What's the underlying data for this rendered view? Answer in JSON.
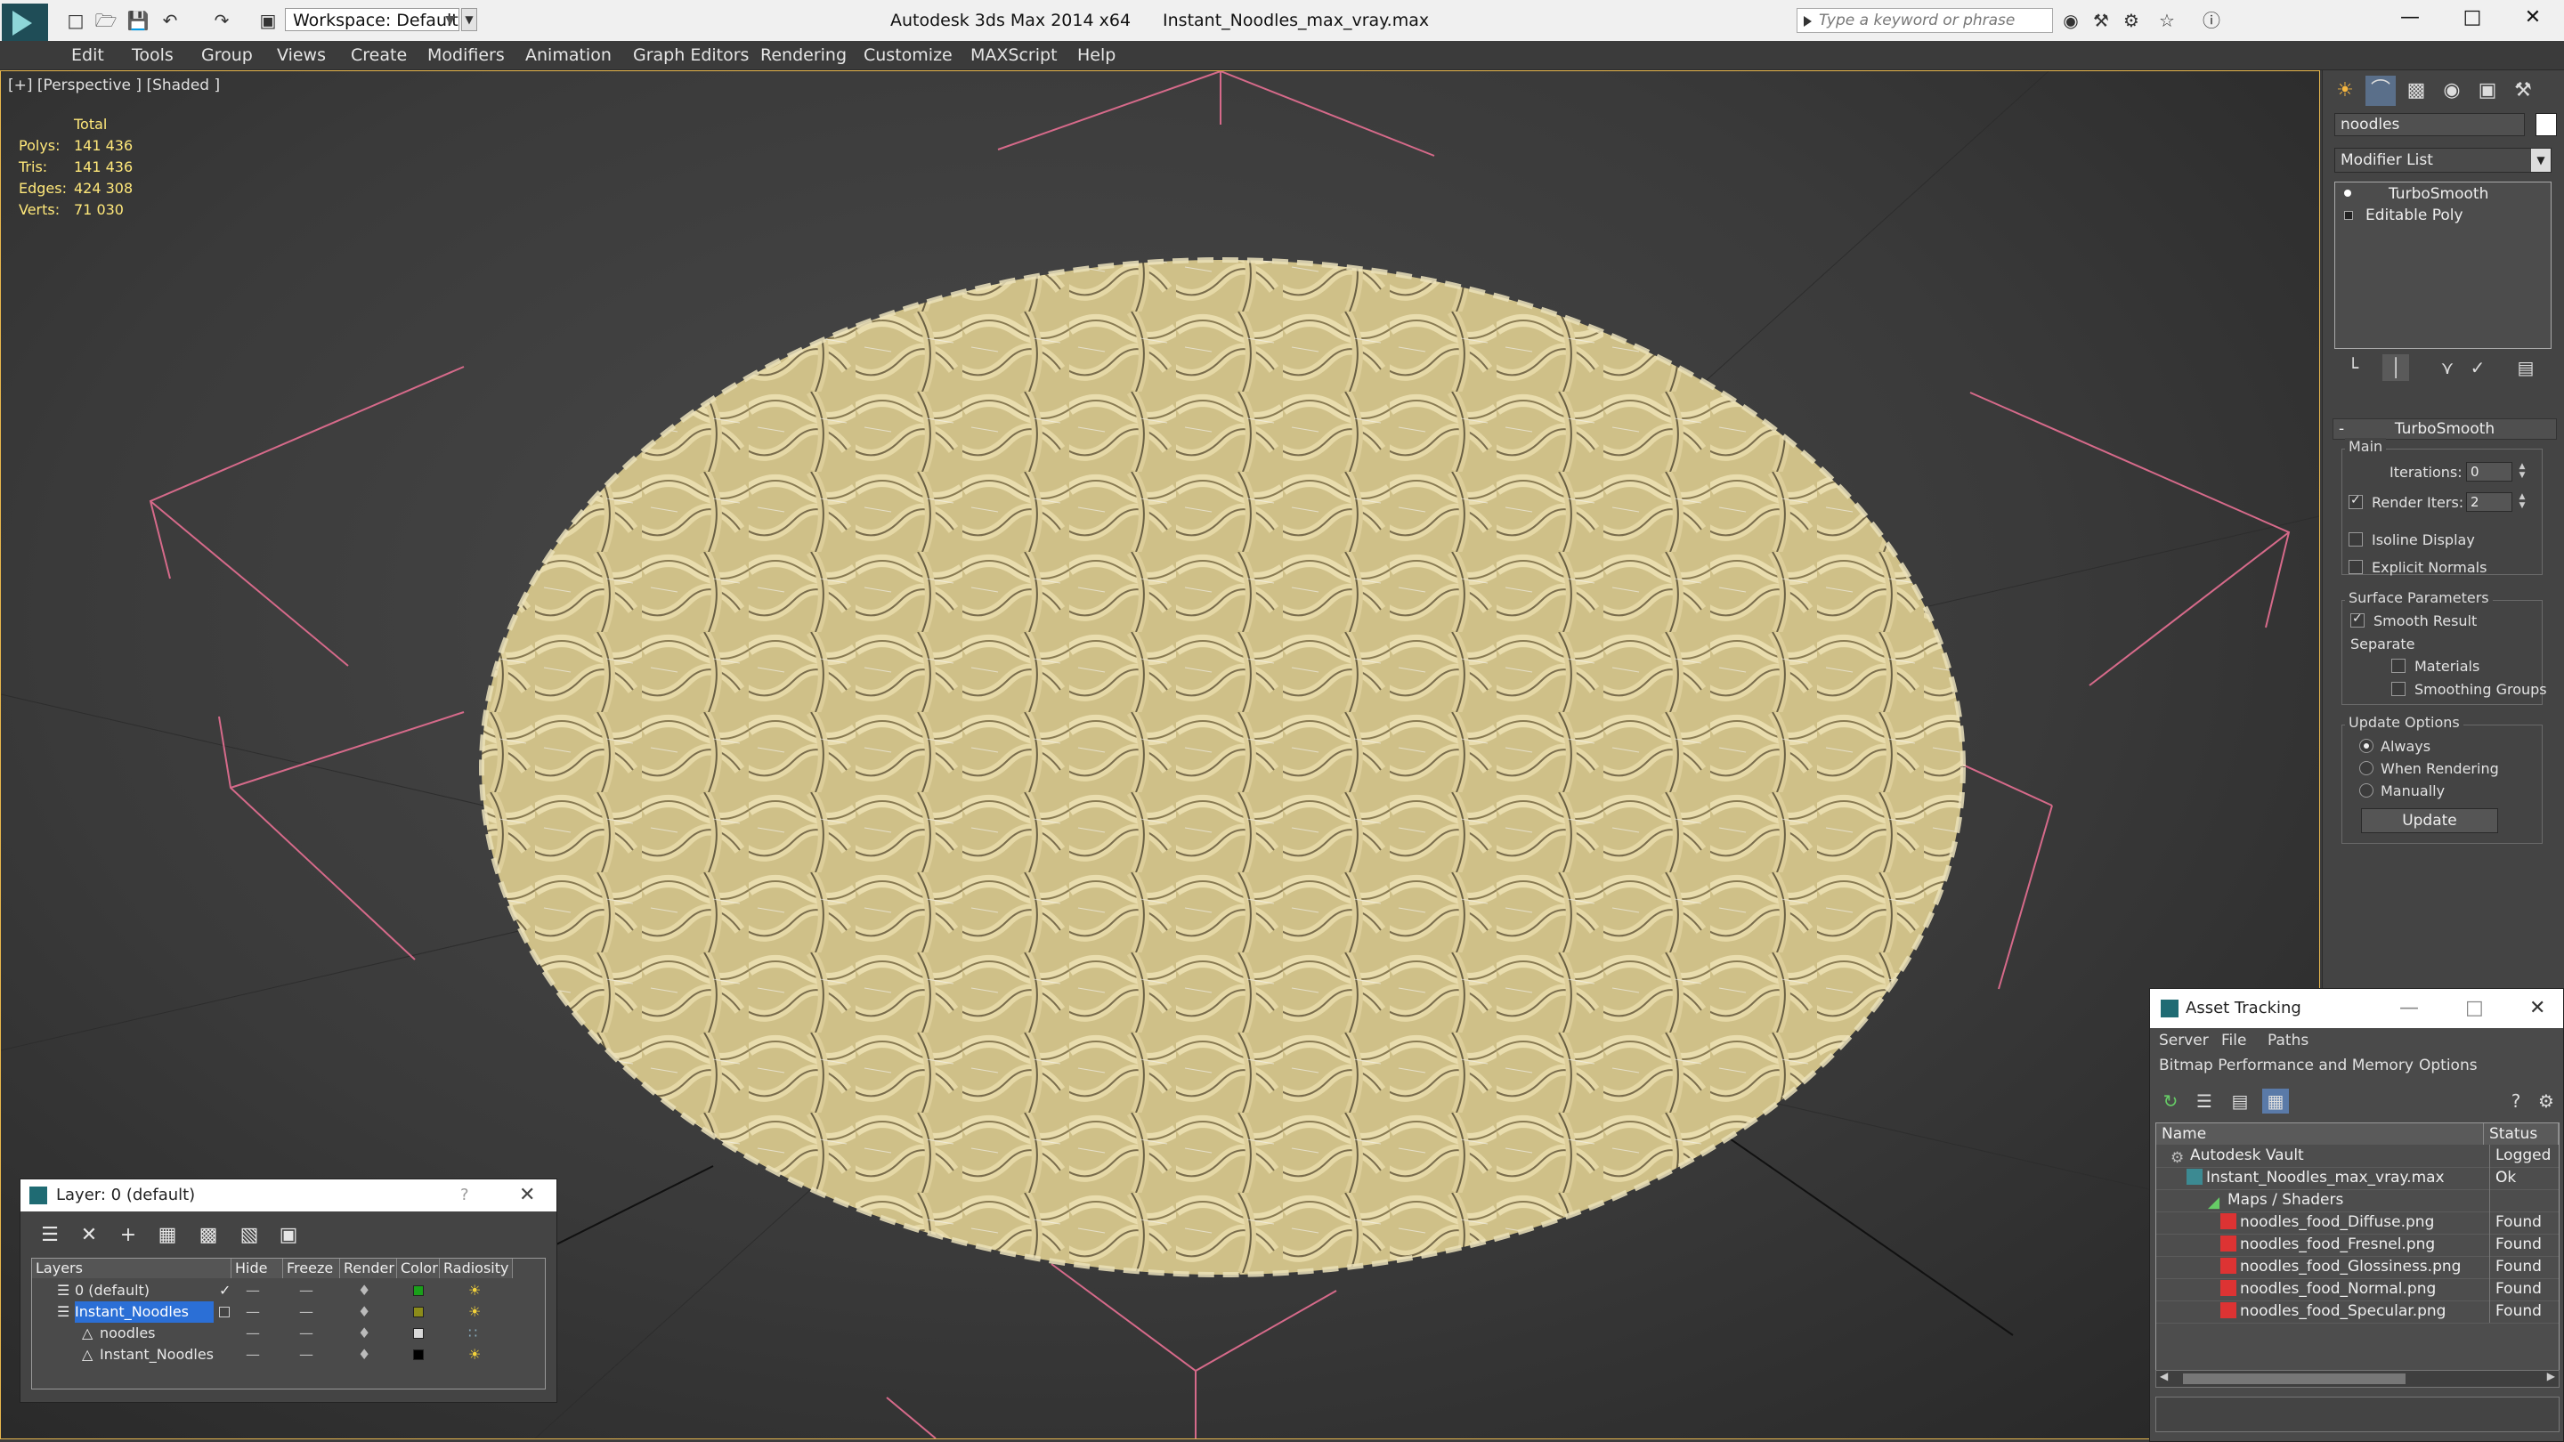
{
  "titlebar": {
    "workspace": "Workspace: Default",
    "app_name": "Autodesk 3ds Max  2014 x64",
    "file_name": "Instant_Noodles_max_vray.max",
    "search_placeholder": "Type a keyword or phrase"
  },
  "menu": [
    "Edit",
    "Tools",
    "Group",
    "Views",
    "Create",
    "Modifiers",
    "Animation",
    "Graph Editors",
    "Rendering",
    "Customize",
    "MAXScript",
    "Help"
  ],
  "viewport": {
    "label": "[+] [Perspective ] [Shaded ]",
    "stats": {
      "header": "Total",
      "rows": [
        {
          "label": "Polys:",
          "value": "141 436"
        },
        {
          "label": "Tris:",
          "value": "141 436"
        },
        {
          "label": "Edges:",
          "value": "424 308"
        },
        {
          "label": "Verts:",
          "value": "71 030"
        }
      ]
    },
    "object_color": "#e8d9a0"
  },
  "command_panel": {
    "object_name": "noodles",
    "modifier_list": "Modifier List",
    "stack": [
      "TurboSmooth",
      "Editable Poly"
    ],
    "rollout_title": "TurboSmooth",
    "main_group": "Main",
    "iterations_label": "Iterations:",
    "iterations_value": "0",
    "render_iters_label": "Render Iters:",
    "render_iters_value": "2",
    "isoline_label": "Isoline Display",
    "explicit_normals_label": "Explicit Normals",
    "surface_group": "Surface Parameters",
    "smooth_result_label": "Smooth Result",
    "separate_label": "Separate",
    "materials_label": "Materials",
    "smoothing_groups_label": "Smoothing Groups",
    "update_group": "Update Options",
    "always_label": "Always",
    "when_rendering_label": "When Rendering",
    "manually_label": "Manually",
    "update_button": "Update"
  },
  "layer_dialog": {
    "title": "Layer: 0 (default)",
    "help": "?",
    "columns": [
      "Layers",
      "Hide",
      "Freeze",
      "Render",
      "Color",
      "Radiosity"
    ],
    "rows": [
      {
        "name": "0 (default)",
        "color": "#1aa01a"
      },
      {
        "name": "Instant_Noodles",
        "color": "#8c8c1a"
      },
      {
        "name": "noodles",
        "color": "#d9d9d9"
      },
      {
        "name": "Instant_Noodles",
        "color": "#000000"
      }
    ]
  },
  "asset_dialog": {
    "title": "Asset Tracking",
    "menu1": [
      "Server",
      "File",
      "Paths"
    ],
    "menu2": [
      "Bitmap Performance and Memory",
      "Options"
    ],
    "columns": [
      "Name",
      "Status"
    ],
    "rows": [
      {
        "name": "Autodesk Vault",
        "status": "Logged O"
      },
      {
        "name": "Instant_Noodles_max_vray.max",
        "status": "Ok"
      },
      {
        "name": "Maps / Shaders",
        "status": ""
      },
      {
        "name": "noodles_food_Diffuse.png",
        "status": "Found"
      },
      {
        "name": "noodles_food_Fresnel.png",
        "status": "Found"
      },
      {
        "name": "noodles_food_Glossiness.png",
        "status": "Found"
      },
      {
        "name": "noodles_food_Normal.png",
        "status": "Found"
      },
      {
        "name": "noodles_food_Specular.png",
        "status": "Found"
      }
    ]
  }
}
